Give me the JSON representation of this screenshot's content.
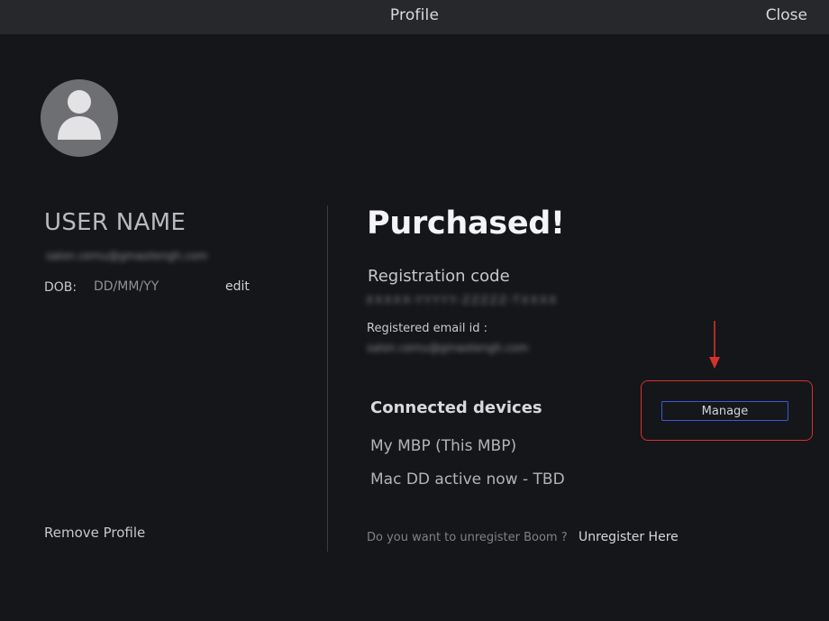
{
  "window": {
    "title": "Profile",
    "close_label": "Close"
  },
  "profile": {
    "avatar_icon": "user-silhouette-icon",
    "username": "USER NAME",
    "email_blurred": "salon.cemu@gmaotengh.com",
    "dob_label": "DOB:",
    "dob_value": "DD/MM/YY",
    "edit_label": "edit",
    "remove_label": "Remove Profile"
  },
  "purchase": {
    "status_heading": "Purchased!",
    "registration_code_label": "Registration code",
    "registration_code_value": "XXXXX-YYYYY-ZZZZZ-TXXXX",
    "registered_email_label": "Registered  email id :",
    "registered_email_value": "salon.cemu@gmaotengh.com"
  },
  "devices": {
    "heading": "Connected devices",
    "items": [
      "My MBP (This MBP)",
      "Mac DD active now - TBD"
    ],
    "manage_label": "Manage"
  },
  "unregister": {
    "question": "Do you want to unregister Boom ?",
    "link_label": "Unregister Here"
  },
  "colors": {
    "background": "#151619",
    "titlebar": "#27282c",
    "annotation_red": "#d6312b",
    "manage_border_blue": "#3a58d6"
  }
}
